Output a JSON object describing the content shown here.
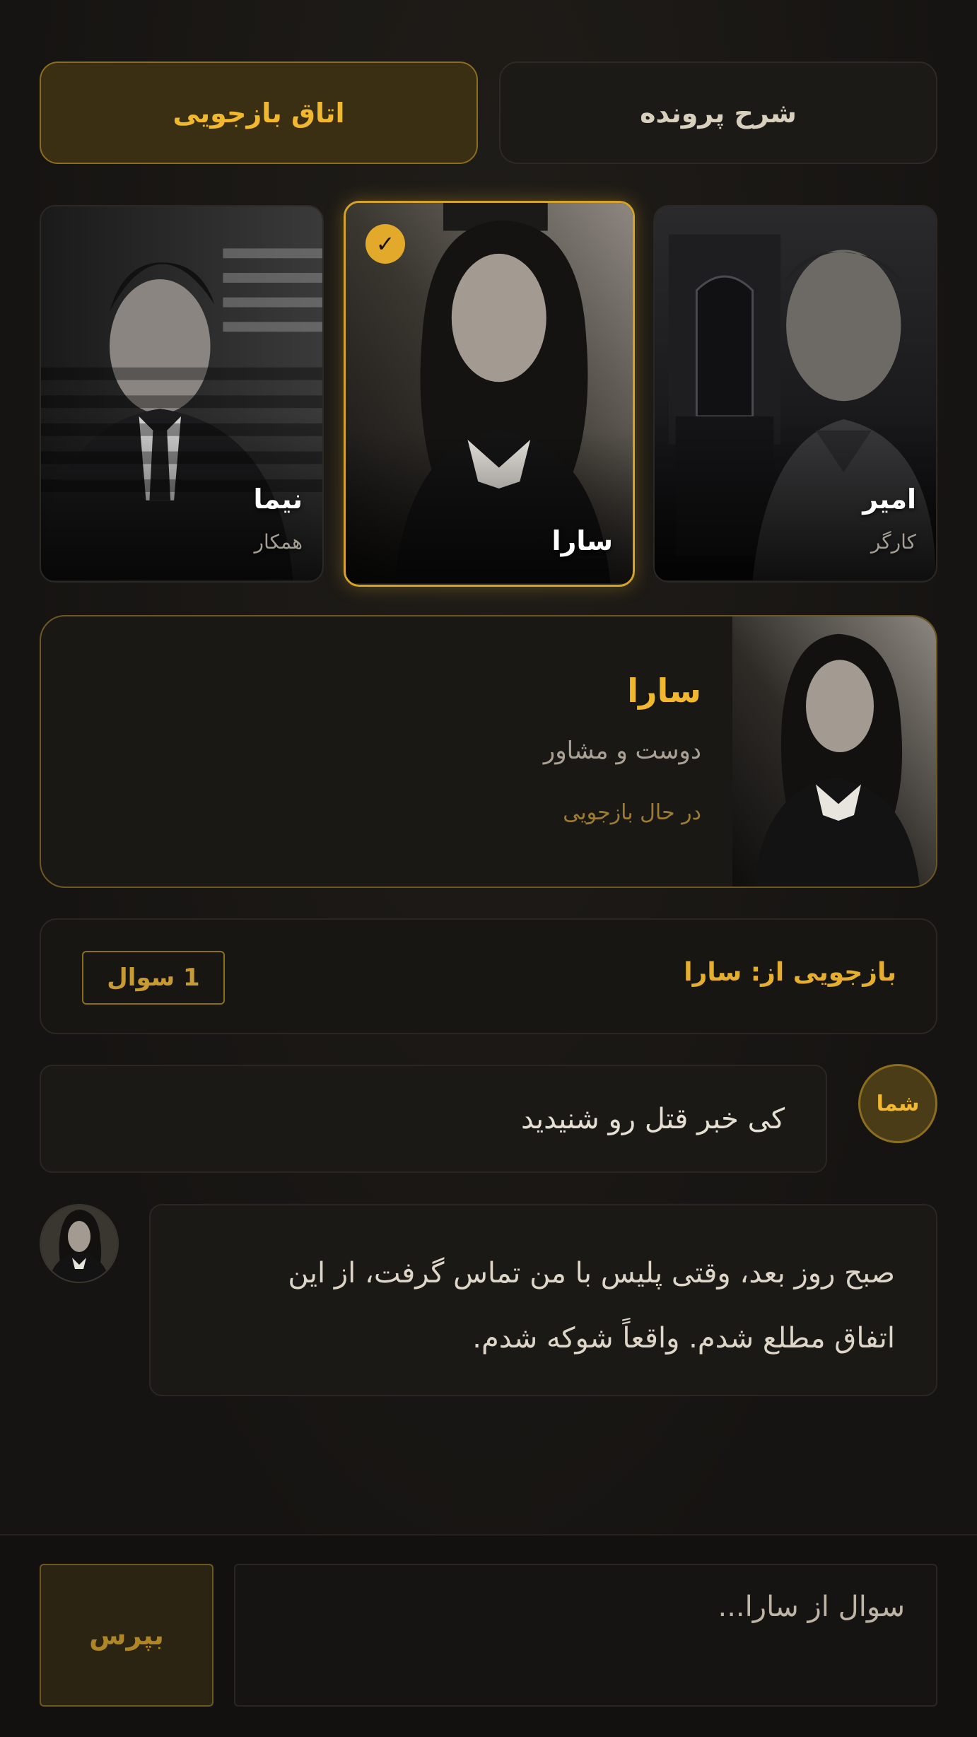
{
  "tabs": {
    "case_summary": "شرح پرونده",
    "interrogation_room": "اتاق بازجویی"
  },
  "suspects": [
    {
      "name": "امیر",
      "role": "کارگر"
    },
    {
      "name": "سارا",
      "role": "",
      "selected": true
    },
    {
      "name": "نیما",
      "role": "همکار"
    }
  ],
  "profile": {
    "name": "سارا",
    "role": "دوست و مشاور",
    "status": "در حال بازجویی"
  },
  "interrogation": {
    "title": "بازجویی از: سارا",
    "question_count": "1 سوال"
  },
  "chat": {
    "user_label": "شما",
    "user_message": "کی خبر قتل رو شنیدید",
    "reply_line1": "صبح روز بعد، وقتی پلیس با من تماس گرفت، از این",
    "reply_line2": "اتفاق مطلع شدم. واقعاً شوکه شدم."
  },
  "composer": {
    "placeholder": "سوال از سارا...",
    "ask_label": "بپرس"
  },
  "colors": {
    "accent": "#f0b72f",
    "background": "#161412",
    "border_gold": "#8a6d1f"
  }
}
